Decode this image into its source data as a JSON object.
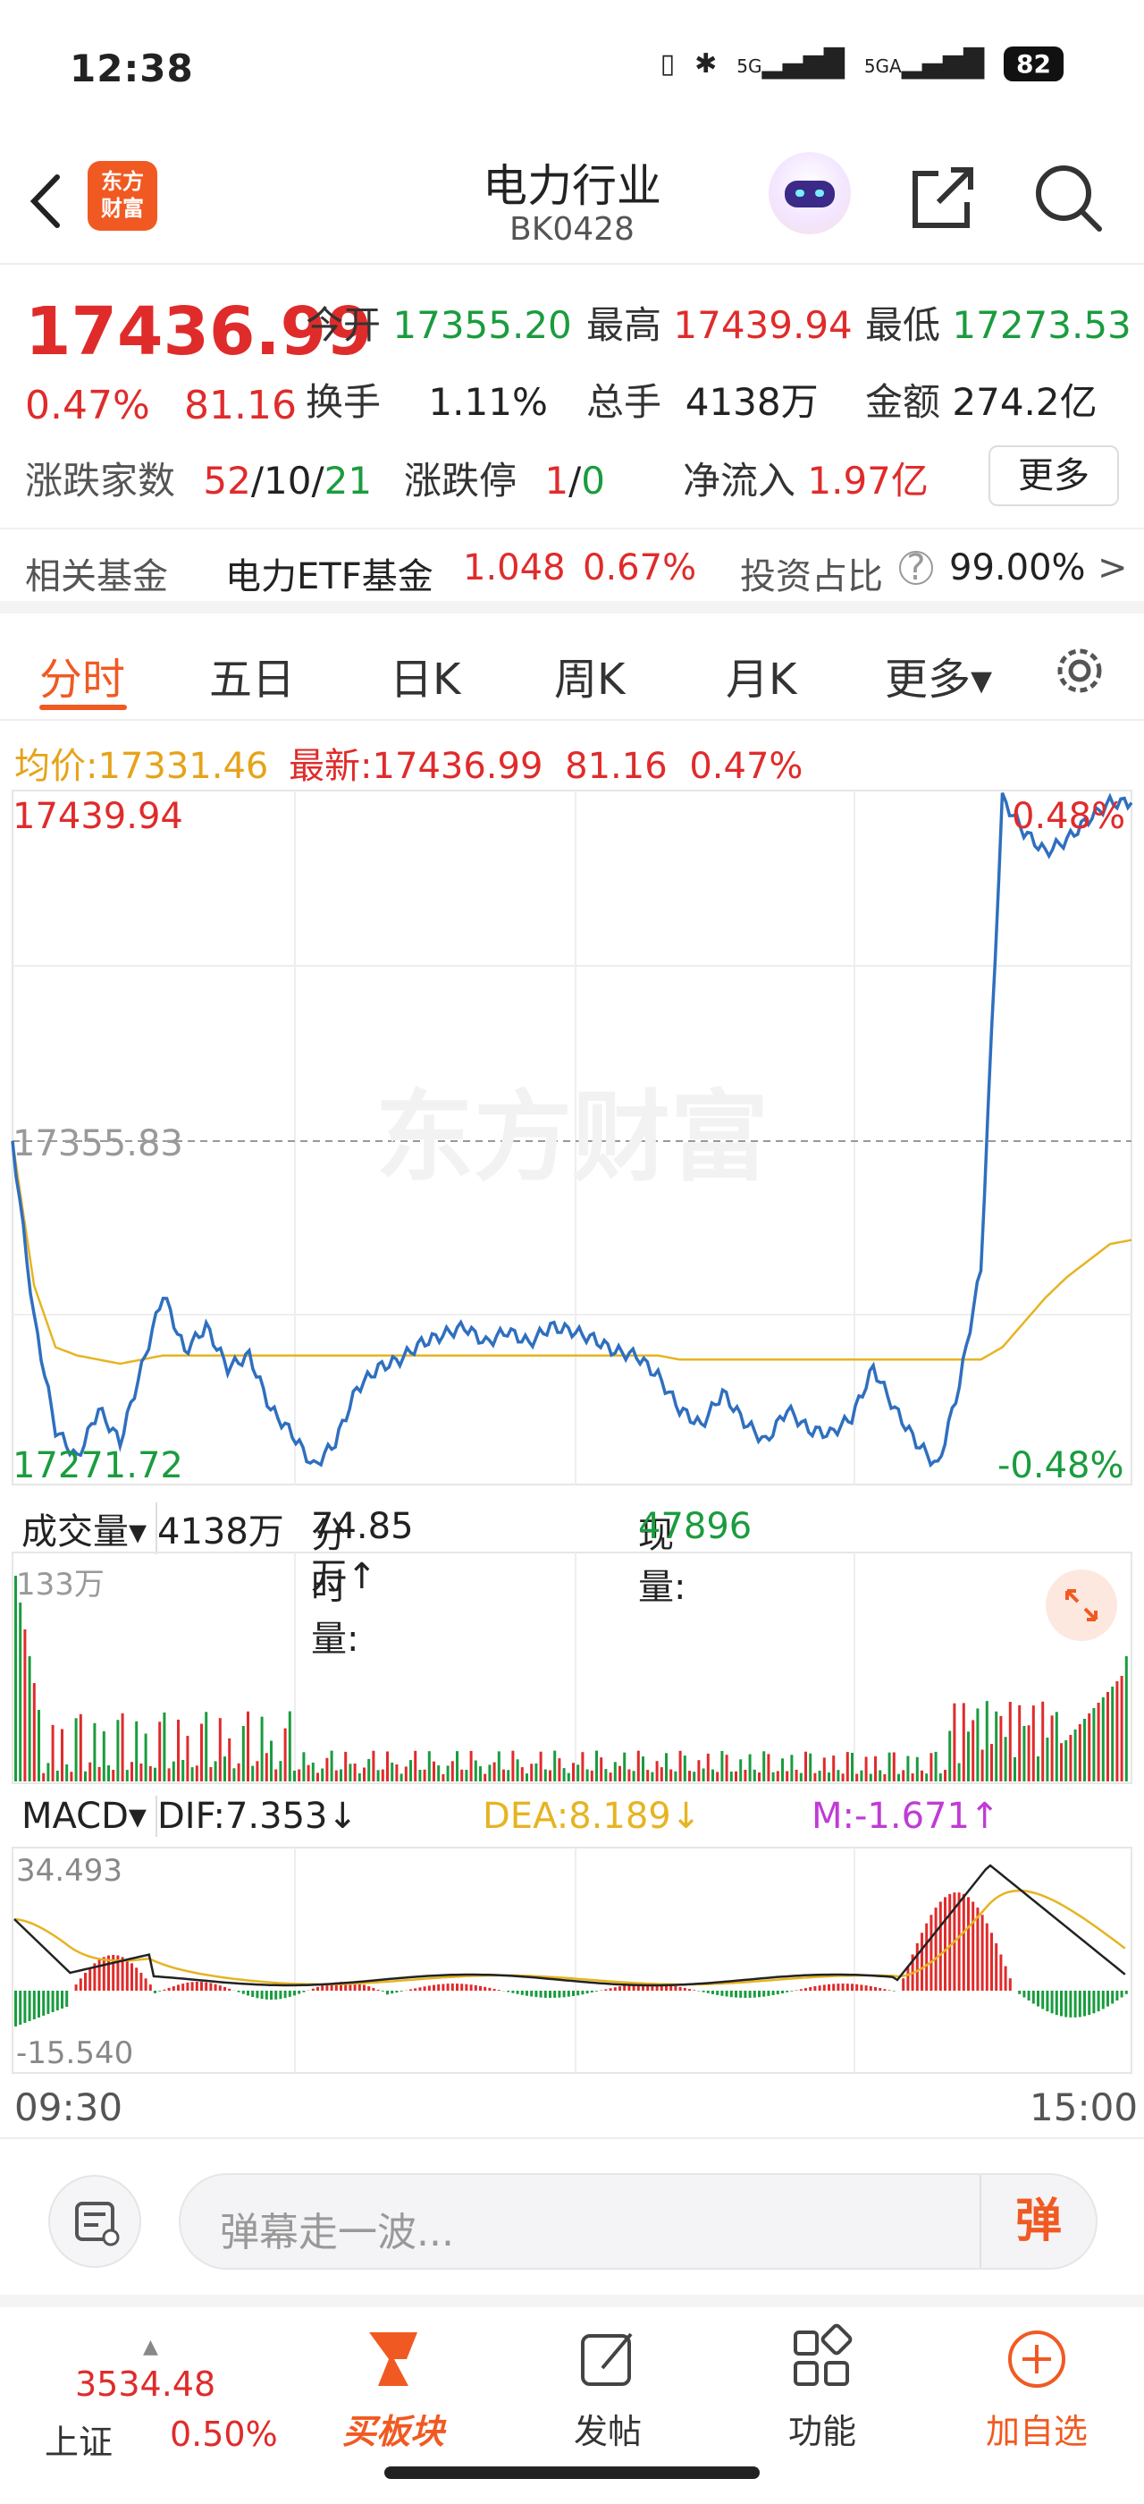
{
  "status_bar": {
    "time": "12:38",
    "network1": "5G",
    "network2": "5GA",
    "battery": "82"
  },
  "header": {
    "logo_line1": "东方",
    "logo_line2": "财富",
    "title": "电力行业",
    "code": "BK0428"
  },
  "quote": {
    "price": "17436.99",
    "change_pct": "0.47%",
    "change_abs": "81.16",
    "open_label": "今开",
    "open": "17355.20",
    "high_label": "最高",
    "high": "17439.94",
    "low_label": "最低",
    "low": "17273.53",
    "turnover_label": "换手",
    "turnover": "1.11%",
    "volume_label": "总手",
    "volume": "4138万",
    "amount_label": "金额",
    "amount": "274.2亿",
    "breadth_label": "涨跌家数",
    "breadth_up": "52",
    "breadth_sep1": "/",
    "breadth_flat": "10",
    "breadth_sep2": "/",
    "breadth_down": "21",
    "limit_label": "涨跌停",
    "limit_up": "1",
    "limit_sep": "/",
    "limit_down": "0",
    "netflow_label": "净流入",
    "netflow": "1.97亿",
    "more_button": "更多"
  },
  "fund_row": {
    "label": "相关基金",
    "fund_name": "电力ETF基金",
    "fund_price": "1.048",
    "fund_change": "0.67%",
    "ratio_label": "投资占比",
    "ratio_value": "99.00%",
    "arrow": ">"
  },
  "tabs": [
    "分时",
    "五日",
    "日K",
    "周K",
    "月K",
    "更多▾"
  ],
  "intraday_info": {
    "avg_label": "均价:",
    "avg_value": "17331.46",
    "latest_label": "最新:",
    "latest_value": "17436.99",
    "latest_change": "81.16",
    "latest_pct": "0.47%"
  },
  "main_chart": {
    "y_max_label": "17439.94",
    "y_mid_label": "17355.83",
    "y_min_label": "17271.72",
    "pct_top": "0.48%",
    "pct_bottom": "-0.48%",
    "watermark": "东方财富",
    "colors": {
      "price": "#2f6fbf",
      "avg": "#e6b422",
      "up": "#e02b2b",
      "down": "#1a9c3e"
    }
  },
  "chart_data": {
    "type": "line",
    "x_range": [
      "09:30",
      "15:00"
    ],
    "ylim": [
      17271.72,
      17439.94
    ],
    "baseline": 17355.83,
    "series": [
      {
        "name": "price",
        "values": [
          17355,
          17312,
          17285,
          17278,
          17290,
          17282,
          17300,
          17318,
          17304,
          17310,
          17300,
          17303,
          17290,
          17284,
          17276,
          17282,
          17295,
          17300,
          17302,
          17306,
          17308,
          17310,
          17306,
          17309,
          17306,
          17310,
          17309,
          17307,
          17304,
          17303,
          17298,
          17290,
          17286,
          17294,
          17287,
          17282,
          17290,
          17285,
          17284,
          17288,
          17300,
          17290,
          17282,
          17276,
          17296,
          17324,
          17438,
          17430,
          17425,
          17428,
          17433,
          17437,
          17437
        ]
      },
      {
        "name": "avg",
        "values": [
          17355,
          17320,
          17305,
          17303,
          17302,
          17301,
          17302,
          17303,
          17303,
          17303,
          17303,
          17303,
          17303,
          17303,
          17303,
          17303,
          17303,
          17303,
          17303,
          17303,
          17303,
          17303,
          17303,
          17303,
          17303,
          17303,
          17303,
          17303,
          17303,
          17303,
          17303,
          17302,
          17302,
          17302,
          17302,
          17302,
          17302,
          17302,
          17302,
          17302,
          17302,
          17302,
          17302,
          17302,
          17302,
          17302,
          17305,
          17311,
          17317,
          17322,
          17326,
          17330,
          17331
        ]
      }
    ]
  },
  "volume_bar": {
    "select_label": "成交量▾",
    "total": "4138万",
    "minute_label": "分时量:",
    "minute_value": "74.85万↑",
    "current_label": "现量:",
    "current_value": "47896",
    "scale_label": "133万"
  },
  "macd_bar": {
    "select_label": "MACD▾",
    "dif": "DIF:7.353↓",
    "dea": "DEA:8.189↓",
    "m": "M:-1.671↑",
    "scale_top": "34.493",
    "scale_bottom": "-15.540",
    "colors": {
      "dif": "#222222",
      "dea": "#e6b422",
      "m": "#c03bd6"
    }
  },
  "time_axis": {
    "start": "09:30",
    "end": "15:00"
  },
  "danmaku": {
    "placeholder": "弹幕走一波...",
    "send_label": "弹"
  },
  "bottom_nav": {
    "index_value": "3534.48",
    "index_name": "上证",
    "index_change": "0.50%",
    "items": [
      "买板块",
      "发帖",
      "功能",
      "加自选"
    ]
  }
}
